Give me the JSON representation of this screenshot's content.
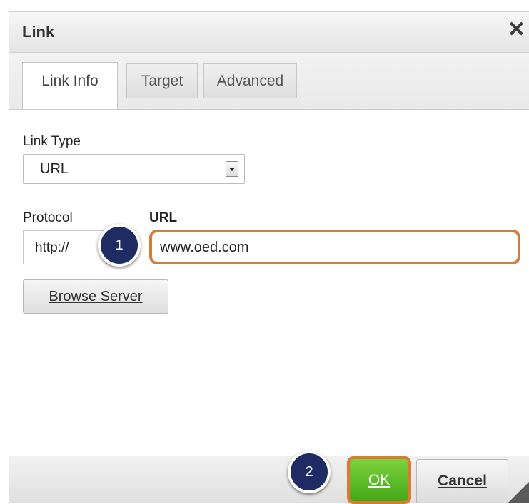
{
  "dialog": {
    "title": "Link",
    "close_icon": "close-icon"
  },
  "tabs": [
    {
      "label": "Link Info",
      "active": true
    },
    {
      "label": "Target",
      "active": false
    },
    {
      "label": "Advanced",
      "active": false
    }
  ],
  "link_type": {
    "label": "Link Type",
    "value": "URL"
  },
  "protocol": {
    "label": "Protocol",
    "value": "http://"
  },
  "url": {
    "label": "URL",
    "value": "www.oed.com"
  },
  "browse_button": "Browse Server",
  "footer": {
    "ok_label": "OK",
    "cancel_label": "Cancel"
  },
  "markers": [
    "1",
    "2"
  ],
  "colors": {
    "highlight": "#d97a35",
    "ok_green": "#45a819",
    "marker_navy": "#1f2b63"
  }
}
